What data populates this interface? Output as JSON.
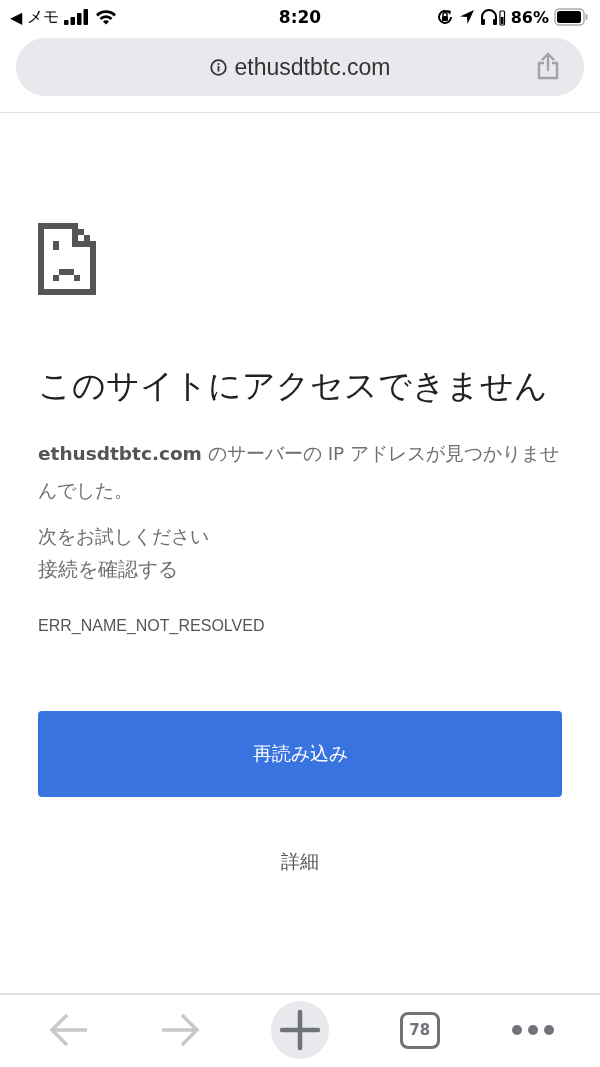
{
  "status_bar": {
    "back_label": "◀",
    "back_app": "メモ",
    "time": "8:20",
    "battery": "86%"
  },
  "address_bar": {
    "url": "ethusdtbtc.com"
  },
  "error": {
    "title": "このサイトにアクセスできません",
    "message": "**ethusdtbtc.com** のサーバーの IP アドレスが見つかりませんでした。",
    "suggestions_heading": "次をお試しください",
    "suggestions": [
      "接続を確認する"
    ],
    "code": "ERR_NAME_NOT_RESOLVED",
    "reload_button": "再読み込み",
    "details_link": "詳細"
  },
  "toolbar": {
    "back_disabled": true,
    "forward_disabled": true,
    "tab_count": "78"
  }
}
